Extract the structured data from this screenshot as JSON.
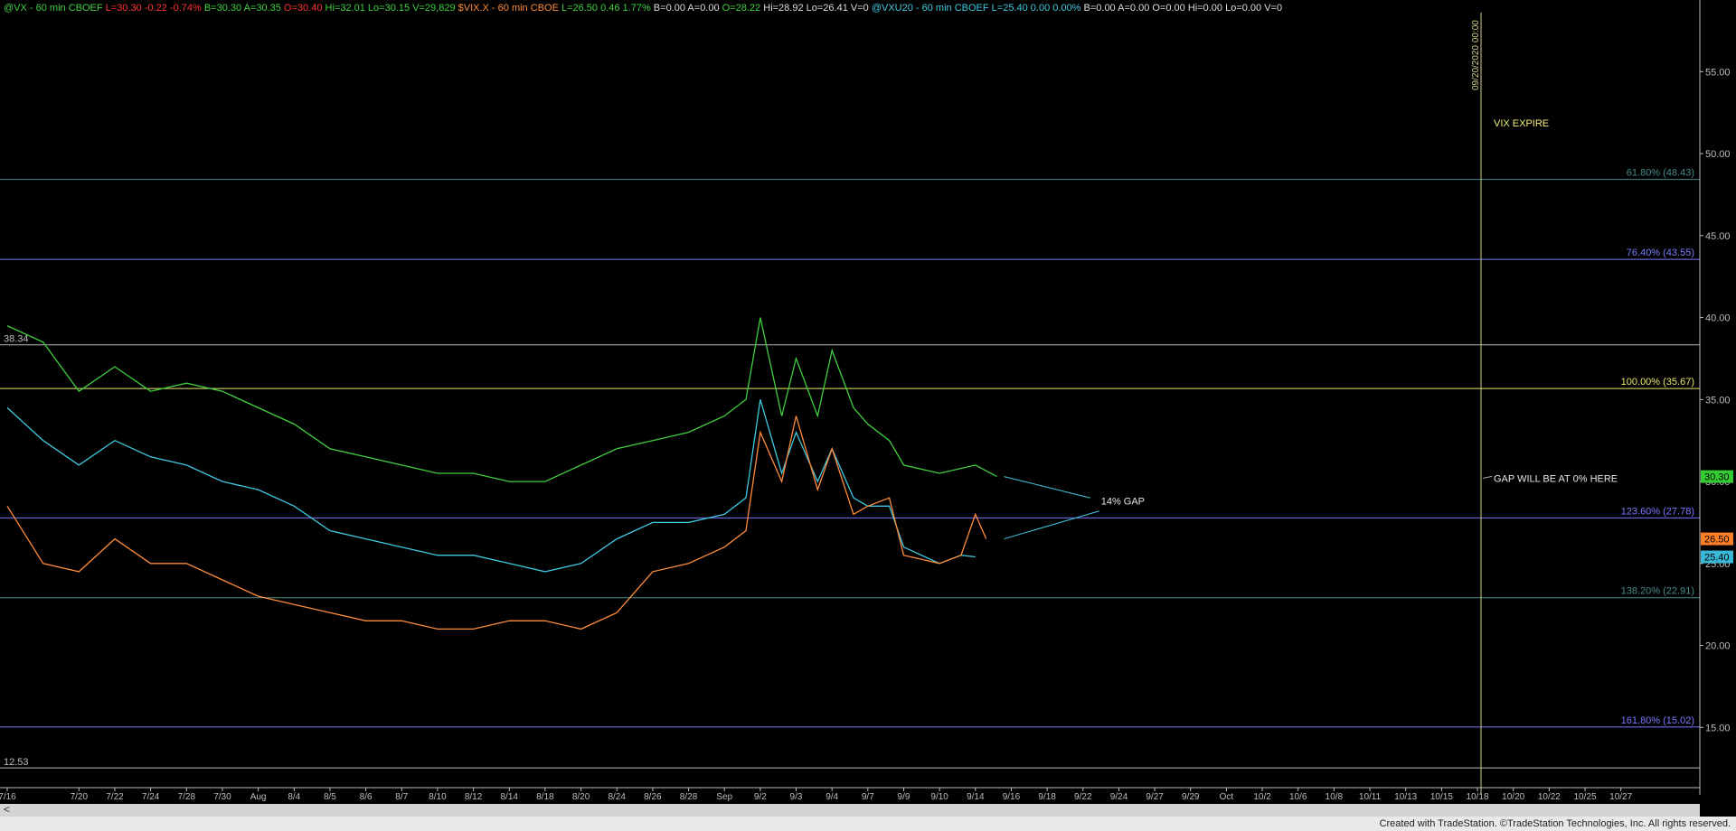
{
  "header": {
    "segments": [
      {
        "text": "@VX - 60 min",
        "color": "#3fcf3f"
      },
      {
        "text": "CBOEF",
        "color": "#3fcf3f"
      },
      {
        "text": "L=30.30",
        "color": "#ff3333"
      },
      {
        "text": "-0.22",
        "color": "#ff3333"
      },
      {
        "text": "-0.74%",
        "color": "#ff3333"
      },
      {
        "text": "B=30.30",
        "color": "#3fcf3f"
      },
      {
        "text": "A=30.35",
        "color": "#3fcf3f"
      },
      {
        "text": "O=30.40",
        "color": "#ff3333"
      },
      {
        "text": "Hi=32.01",
        "color": "#3fcf3f"
      },
      {
        "text": "Lo=30.15",
        "color": "#3fcf3f"
      },
      {
        "text": "V=29,829",
        "color": "#3fcf3f"
      },
      {
        "text": "$VIX.X - 60 min",
        "color": "#ff8c3a"
      },
      {
        "text": "CBOE",
        "color": "#ff8c3a"
      },
      {
        "text": "L=26.50",
        "color": "#3fcf3f"
      },
      {
        "text": "0.46",
        "color": "#3fcf3f"
      },
      {
        "text": "1.77%",
        "color": "#3fcf3f"
      },
      {
        "text": "B=0.00",
        "color": "#dddddd"
      },
      {
        "text": "A=0.00",
        "color": "#dddddd"
      },
      {
        "text": "O=28.22",
        "color": "#3fcf3f"
      },
      {
        "text": "Hi=28.92",
        "color": "#dddddd"
      },
      {
        "text": "Lo=26.41",
        "color": "#dddddd"
      },
      {
        "text": "V=0",
        "color": "#dddddd"
      },
      {
        "text": "@VXU20 - 60 min",
        "color": "#40c8e0"
      },
      {
        "text": "CBOEF",
        "color": "#40c8e0"
      },
      {
        "text": "L=25.40",
        "color": "#40c8e0"
      },
      {
        "text": "0.00",
        "color": "#40c8e0"
      },
      {
        "text": "0.00%",
        "color": "#40c8e0"
      },
      {
        "text": "B=0.00",
        "color": "#dddddd"
      },
      {
        "text": "A=0.00",
        "color": "#dddddd"
      },
      {
        "text": "O=0.00",
        "color": "#dddddd"
      },
      {
        "text": "Hi=0.00",
        "color": "#dddddd"
      },
      {
        "text": "Lo=0.00",
        "color": "#dddddd"
      },
      {
        "text": "V=0",
        "color": "#dddddd"
      }
    ]
  },
  "footer": {
    "text": "Created with TradeStation. ©TradeStation Technologies, Inc. All rights reserved."
  },
  "chart_data": {
    "type": "line",
    "ylim": [
      11.6,
      58.6
    ],
    "y_ticks": [
      "55.00",
      "50.00",
      "45.00",
      "40.00",
      "35.00",
      "30.00",
      "25.00",
      "20.00",
      "15.00"
    ],
    "y_tick_values": [
      55,
      50,
      45,
      40,
      35,
      30,
      25,
      20,
      15
    ],
    "x_ticks": [
      "7/16",
      "7/20",
      "7/22",
      "7/24",
      "7/28",
      "7/30",
      "Aug",
      "8/4",
      "8/5",
      "8/6",
      "8/7",
      "8/10",
      "8/12",
      "8/14",
      "8/18",
      "8/20",
      "8/24",
      "8/26",
      "8/28",
      "Sep",
      "9/2",
      "9/3",
      "9/4",
      "9/7",
      "9/9",
      "9/10",
      "9/14",
      "9/16",
      "9/18",
      "9/22",
      "9/24",
      "9/27",
      "9/29",
      "Oct",
      "10/2",
      "10/6",
      "10/8",
      "10/11",
      "10/13",
      "10/15",
      "10/18",
      "10/20",
      "10/22",
      "10/25",
      "10/27"
    ],
    "x_tick_index": [
      0,
      2,
      3,
      4,
      5,
      6,
      7,
      8,
      9,
      10,
      11,
      12,
      13,
      14,
      15,
      16,
      17,
      18,
      19,
      20,
      21,
      22,
      23,
      24,
      25,
      26,
      27,
      28,
      29,
      30,
      31,
      32,
      33,
      34,
      35,
      36,
      37,
      38,
      39,
      40,
      41,
      42,
      43,
      44,
      45
    ],
    "x_index_max": 47,
    "series": [
      {
        "name": "@VX - 60 min",
        "color": "#3fcf3f",
        "x": [
          0,
          1,
          2,
          3,
          4,
          5,
          6,
          7,
          8,
          9,
          10,
          11,
          12,
          13,
          14,
          15,
          16,
          17,
          18,
          19,
          20,
          20.6,
          21,
          21.6,
          22,
          22.6,
          23,
          23.6,
          24,
          24.6,
          25,
          26,
          27,
          27.6
        ],
        "values": [
          39.5,
          38.5,
          35.5,
          37.0,
          35.5,
          36.0,
          35.5,
          34.5,
          33.5,
          32.0,
          31.5,
          31.0,
          30.5,
          30.5,
          30.0,
          30.0,
          31.0,
          32.0,
          32.5,
          33.0,
          34.0,
          35.0,
          40.0,
          34.0,
          37.5,
          34.0,
          38.0,
          34.5,
          33.5,
          32.5,
          31.0,
          30.5,
          31.0,
          30.3
        ]
      },
      {
        "name": "@VXU20 - 60 min",
        "color": "#40c8e0",
        "x": [
          0,
          1,
          2,
          3,
          4,
          5,
          6,
          7,
          8,
          9,
          10,
          11,
          12,
          13,
          14,
          15,
          16,
          17,
          18,
          19,
          20,
          20.6,
          21,
          21.6,
          22,
          22.6,
          23,
          23.6,
          24,
          24.6,
          25,
          26,
          26.6,
          27
        ],
        "values": [
          34.5,
          32.5,
          31.0,
          32.5,
          31.5,
          31.0,
          30.0,
          29.5,
          28.5,
          27.0,
          26.5,
          26.0,
          25.5,
          25.5,
          25.0,
          24.5,
          25.0,
          26.5,
          27.5,
          27.5,
          28.0,
          29.0,
          35.0,
          30.5,
          33.0,
          30.0,
          32.0,
          29.0,
          28.5,
          28.5,
          26.0,
          25.0,
          25.5,
          25.4
        ]
      },
      {
        "name": "$VIX.X - 60 min",
        "color": "#ff8c3a",
        "x": [
          0,
          1,
          2,
          3,
          4,
          5,
          6,
          7,
          8,
          9,
          10,
          11,
          12,
          13,
          14,
          15,
          16,
          17,
          18,
          19,
          20,
          20.6,
          21,
          21.6,
          22,
          22.6,
          23,
          23.6,
          24,
          24.6,
          25,
          26,
          26.6,
          27,
          27.3
        ],
        "values": [
          28.5,
          25.0,
          24.5,
          26.5,
          25.0,
          25.0,
          24.0,
          23.0,
          22.5,
          22.0,
          21.5,
          21.5,
          21.0,
          21.0,
          21.5,
          21.5,
          21.0,
          22.0,
          24.5,
          25.0,
          26.0,
          27.0,
          33.0,
          30.0,
          34.0,
          29.5,
          32.0,
          28.0,
          28.5,
          29.0,
          25.5,
          25.0,
          25.5,
          28.0,
          26.5
        ]
      }
    ],
    "horizontal_levels": [
      {
        "label": "61.80% (48.43)",
        "value": 48.43,
        "color": "#4a8a8a"
      },
      {
        "label": "76.40% (43.55)",
        "value": 43.55,
        "color": "#7a7aff"
      },
      {
        "label": "",
        "value": 38.34,
        "color": "#b8b8b8"
      },
      {
        "label": "100.00% (35.67)",
        "value": 35.67,
        "color": "#e8e86a"
      },
      {
        "label": "123.60% (27.78)",
        "value": 27.78,
        "color": "#7a7aff"
      },
      {
        "label": "138.20% (22.91)",
        "value": 22.91,
        "color": "#4a8a8a"
      },
      {
        "label": "161.80% (15.02)",
        "value": 15.02,
        "color": "#7a7aff"
      },
      {
        "label": "",
        "value": 12.53,
        "color": "#b8b8b8"
      }
    ],
    "level_values_left": [
      {
        "text": "38.34",
        "value": 38.34
      },
      {
        "text": "12.53",
        "value": 12.53
      }
    ],
    "last_price_flags": [
      {
        "text": "30.30",
        "value": 30.3,
        "color": "#33cc33"
      },
      {
        "text": "26.50",
        "value": 26.5,
        "color": "#ff7f27"
      },
      {
        "text": "25.40",
        "value": 25.4,
        "color": "#3ab8d8"
      }
    ],
    "vertical_marker": {
      "x": 41.1,
      "color": "#cfcf8a",
      "label": "09/20/2020 00:00"
    },
    "annotations": {
      "vix_expire": "VIX EXPIRE",
      "gap_zero": "GAP WILL BE AT 0% HERE",
      "gap_pct": "14% GAP"
    }
  }
}
